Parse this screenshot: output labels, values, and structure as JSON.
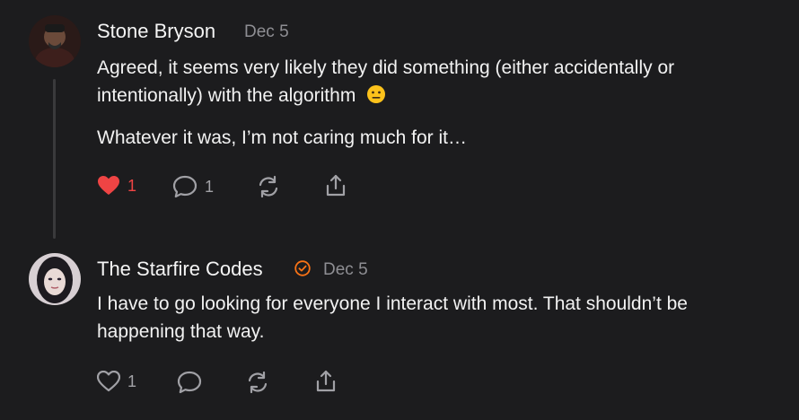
{
  "comments": [
    {
      "author": "Stone Bryson",
      "date": "Dec 5",
      "paragraphs": [
        "Agreed, it seems very likely they did something (either accidentally or",
        "intentionally) with the algorithm",
        "Whatever it was, I’m not caring much for it…"
      ],
      "emoji": "neutral-face-emoji",
      "likes": "1",
      "liked": true,
      "replies": "1",
      "icons": [
        "heart-icon",
        "comment-icon",
        "restack-icon",
        "share-icon"
      ]
    },
    {
      "author": "The Starfire Codes",
      "verified": true,
      "date": "Dec 5",
      "paragraphs": [
        "I have to go looking for everyone I interact with most. That shouldn’t be",
        "happening that way."
      ],
      "likes": "1",
      "liked": false,
      "icons": [
        "heart-icon",
        "comment-icon",
        "restack-icon",
        "share-icon"
      ]
    }
  ],
  "colors": {
    "background": "#1c1c1e",
    "liked": "#ef4444",
    "muted": "#8e8e93",
    "verified": "#f97316"
  }
}
